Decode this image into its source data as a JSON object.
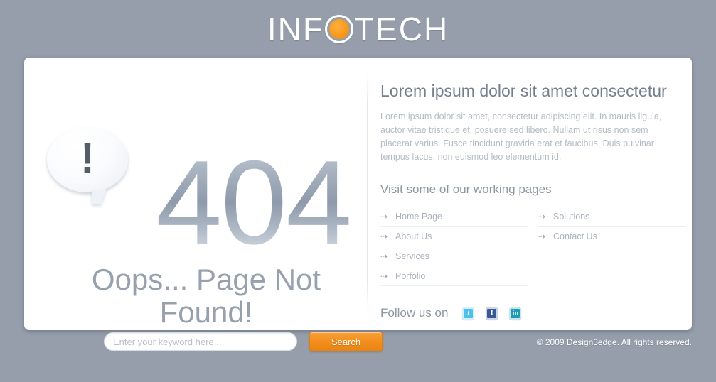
{
  "brand": {
    "name_part1": "INF",
    "logo_dot": "orange-circle-icon",
    "name_part2": "TECH",
    "accent_color": "#f8981d"
  },
  "error": {
    "code": "404",
    "bang": "!",
    "headline": "Oops... Page Not Found!"
  },
  "search": {
    "placeholder": "Enter your keyword here...",
    "value": "",
    "button_label": "Search"
  },
  "panel": {
    "title": "Lorem ipsum dolor sit amet consectetur",
    "body": "Lorem ipsum dolor sit amet, consectetur adipiscing elit. In mauris ligula, auctor vitae tristique et, posuere sed libero. Nullam ut risus non sem placerat varius. Fusce tincidunt gravida erat et faucibus. Duis pulvinar tempus lacus, non euismod leo elementum id.",
    "links_heading": "Visit some of our working pages",
    "links_col1": [
      {
        "label": "Home Page",
        "arrow": "dashed-arrow-icon"
      },
      {
        "label": "About Us",
        "arrow": "dashed-arrow-icon"
      },
      {
        "label": "Services",
        "arrow": "dashed-arrow-icon"
      },
      {
        "label": "Porfolio",
        "arrow": "dashed-arrow-icon"
      }
    ],
    "links_col2": [
      {
        "label": "Solutions",
        "arrow": "dashed-arrow-icon"
      },
      {
        "label": "Contact Us",
        "arrow": "dashed-arrow-icon"
      }
    ],
    "follow_label": "Follow us on",
    "social": [
      {
        "name": "twitter-icon",
        "glyph": "t",
        "color": "#4fc0ea"
      },
      {
        "name": "facebook-icon",
        "glyph": "f",
        "color": "#3a5897"
      },
      {
        "name": "linkedin-icon",
        "glyph": "in",
        "color": "#1f9bb5"
      }
    ]
  },
  "footer": {
    "copyright": "© 2009 Design3edge. All rights reserved."
  },
  "arrow_glyph": "⇢"
}
